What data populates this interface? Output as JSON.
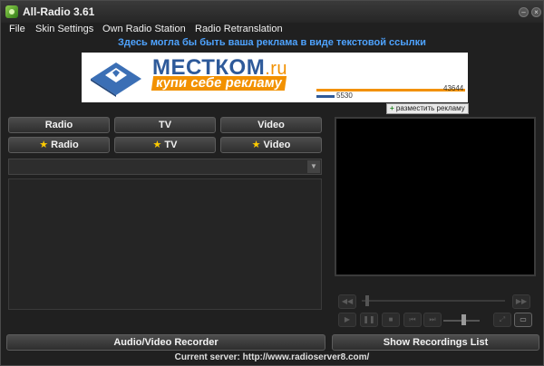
{
  "window": {
    "title": "All-Radio 3.61"
  },
  "menu": {
    "items": [
      "File",
      "Skin Settings",
      "Own Radio Station",
      "Radio Retranslation"
    ]
  },
  "ad": {
    "text_link": "Здесь могла бы быть ваша реклама в виде текстовой ссылки",
    "banner": {
      "brand": "МЕСТКОМ",
      "tld": ".ru",
      "slogan": "купи себе рекламу",
      "stat1": "43644",
      "stat2": "5530"
    },
    "place_ad_label": "разместить рекламу"
  },
  "tabs": {
    "radio": "Radio",
    "tv": "TV",
    "video": "Video"
  },
  "favorites": {
    "radio": "Radio",
    "tv": "TV",
    "video": "Video"
  },
  "recorder_button": "Audio/Video Recorder",
  "recordings_button": "Show Recordings List",
  "status": "Current server: http://www.radioserver8.com/",
  "colors": {
    "accent_link": "#4ea3ff",
    "banner_orange": "#f29100",
    "banner_blue": "#2e5a9a",
    "star": "#ffcc00"
  }
}
